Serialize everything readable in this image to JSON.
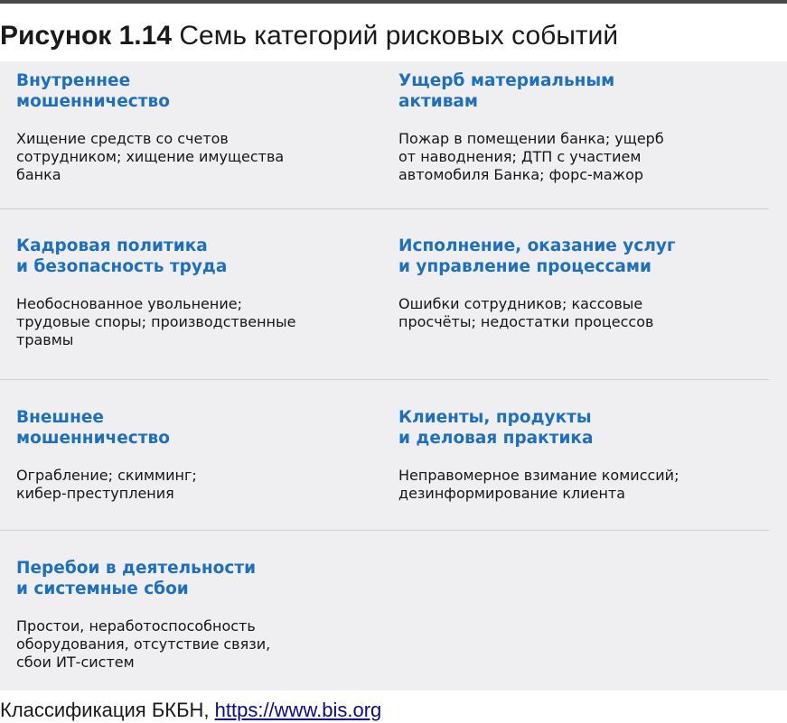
{
  "figure": {
    "number": "Рисунок 1.14",
    "caption": "Семь категорий рисковых событий"
  },
  "categories": [
    {
      "title": "Внутреннее\nмошенничество",
      "description": "Хищение средств со счетов\nсотрудником; хищение имущества\nбанка"
    },
    {
      "title": "Ущерб материальным\nактивам",
      "description": "Пожар в помещении банка; ущерб\nот наводнения; ДТП с участием\nавтомобиля Банка; форс-мажор"
    },
    {
      "title": "Кадровая политика\nи безопасность труда",
      "description": "Необоснованное увольнение;\nтрудовые споры; производственные\nтравмы"
    },
    {
      "title": "Исполнение, оказание услуг\nи управление процессами",
      "description": "Ошибки сотрудников; кассовые\nпросчёты; недостатки процессов"
    },
    {
      "title": "Внешнее\nмошенничество",
      "description": "Ограбление; скимминг;\nкибер-преступления"
    },
    {
      "title": "Клиенты, продукты\nи деловая практика",
      "description": "Неправомерное взимание комиссий;\nдезинформирование клиента"
    },
    {
      "title": "Перебои в деятельности\nи системные сбои",
      "description": "Простои, неработоспособность\nоборудования, отсутствие связи,\nсбои ИТ-систем"
    }
  ],
  "source": {
    "text": "Классификация БКБН, ",
    "link_text": "https://www.bis.org"
  }
}
